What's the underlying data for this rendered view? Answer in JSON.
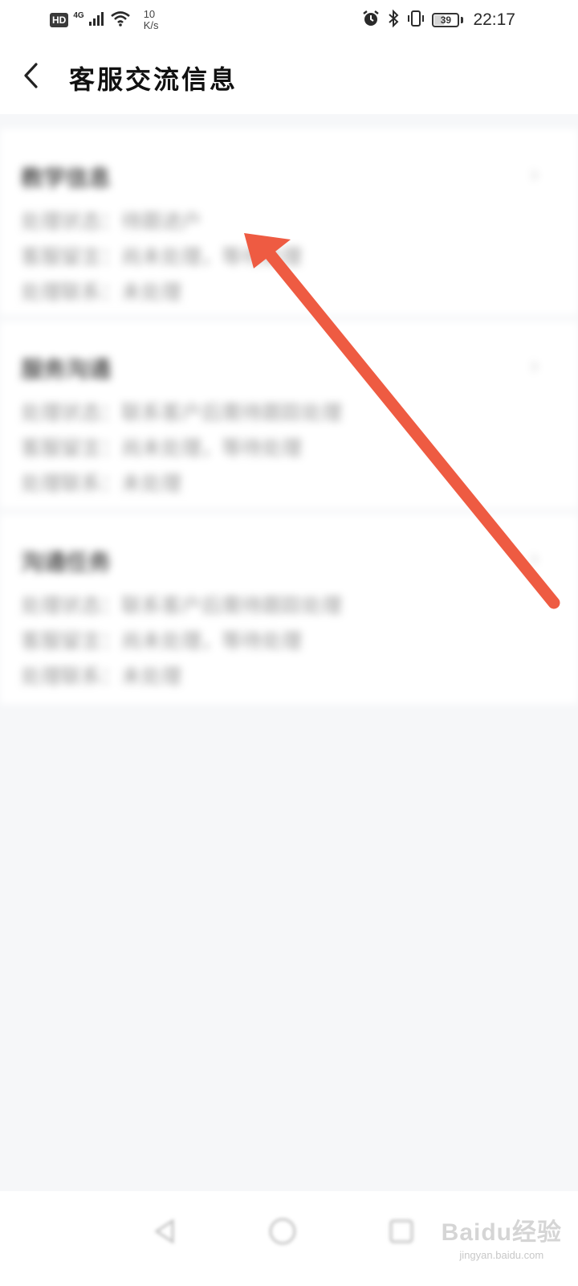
{
  "status_bar": {
    "hd": "HD",
    "network": "4G",
    "speed_value": "10",
    "speed_unit": "K/s",
    "battery": "39",
    "battery_level": 0.39,
    "time": "22:17"
  },
  "header": {
    "title": "客服交流信息"
  },
  "cards": [
    {
      "title": "教学信息",
      "lines": [
        "处理状态：待跟进户",
        "客服留言：尚未处理，等待处理",
        "处理联系：未处理"
      ]
    },
    {
      "title": "服务沟通",
      "lines": [
        "处理状态：联系客户后需待跟踪处理",
        "客服留言：尚未处理，等待处理",
        "处理联系：未处理"
      ]
    },
    {
      "title": "沟通任务",
      "lines": [
        "处理状态：联系客户后需待跟踪处理",
        "客服留言：尚未处理，等待处理",
        "处理联系：未处理"
      ]
    }
  ],
  "watermark": {
    "logo": "Baidu经验",
    "sub": "jingyan.baidu.com"
  },
  "colors": {
    "arrow": "#ee5b42",
    "background": "#f6f7f9",
    "card": "#ffffff"
  }
}
